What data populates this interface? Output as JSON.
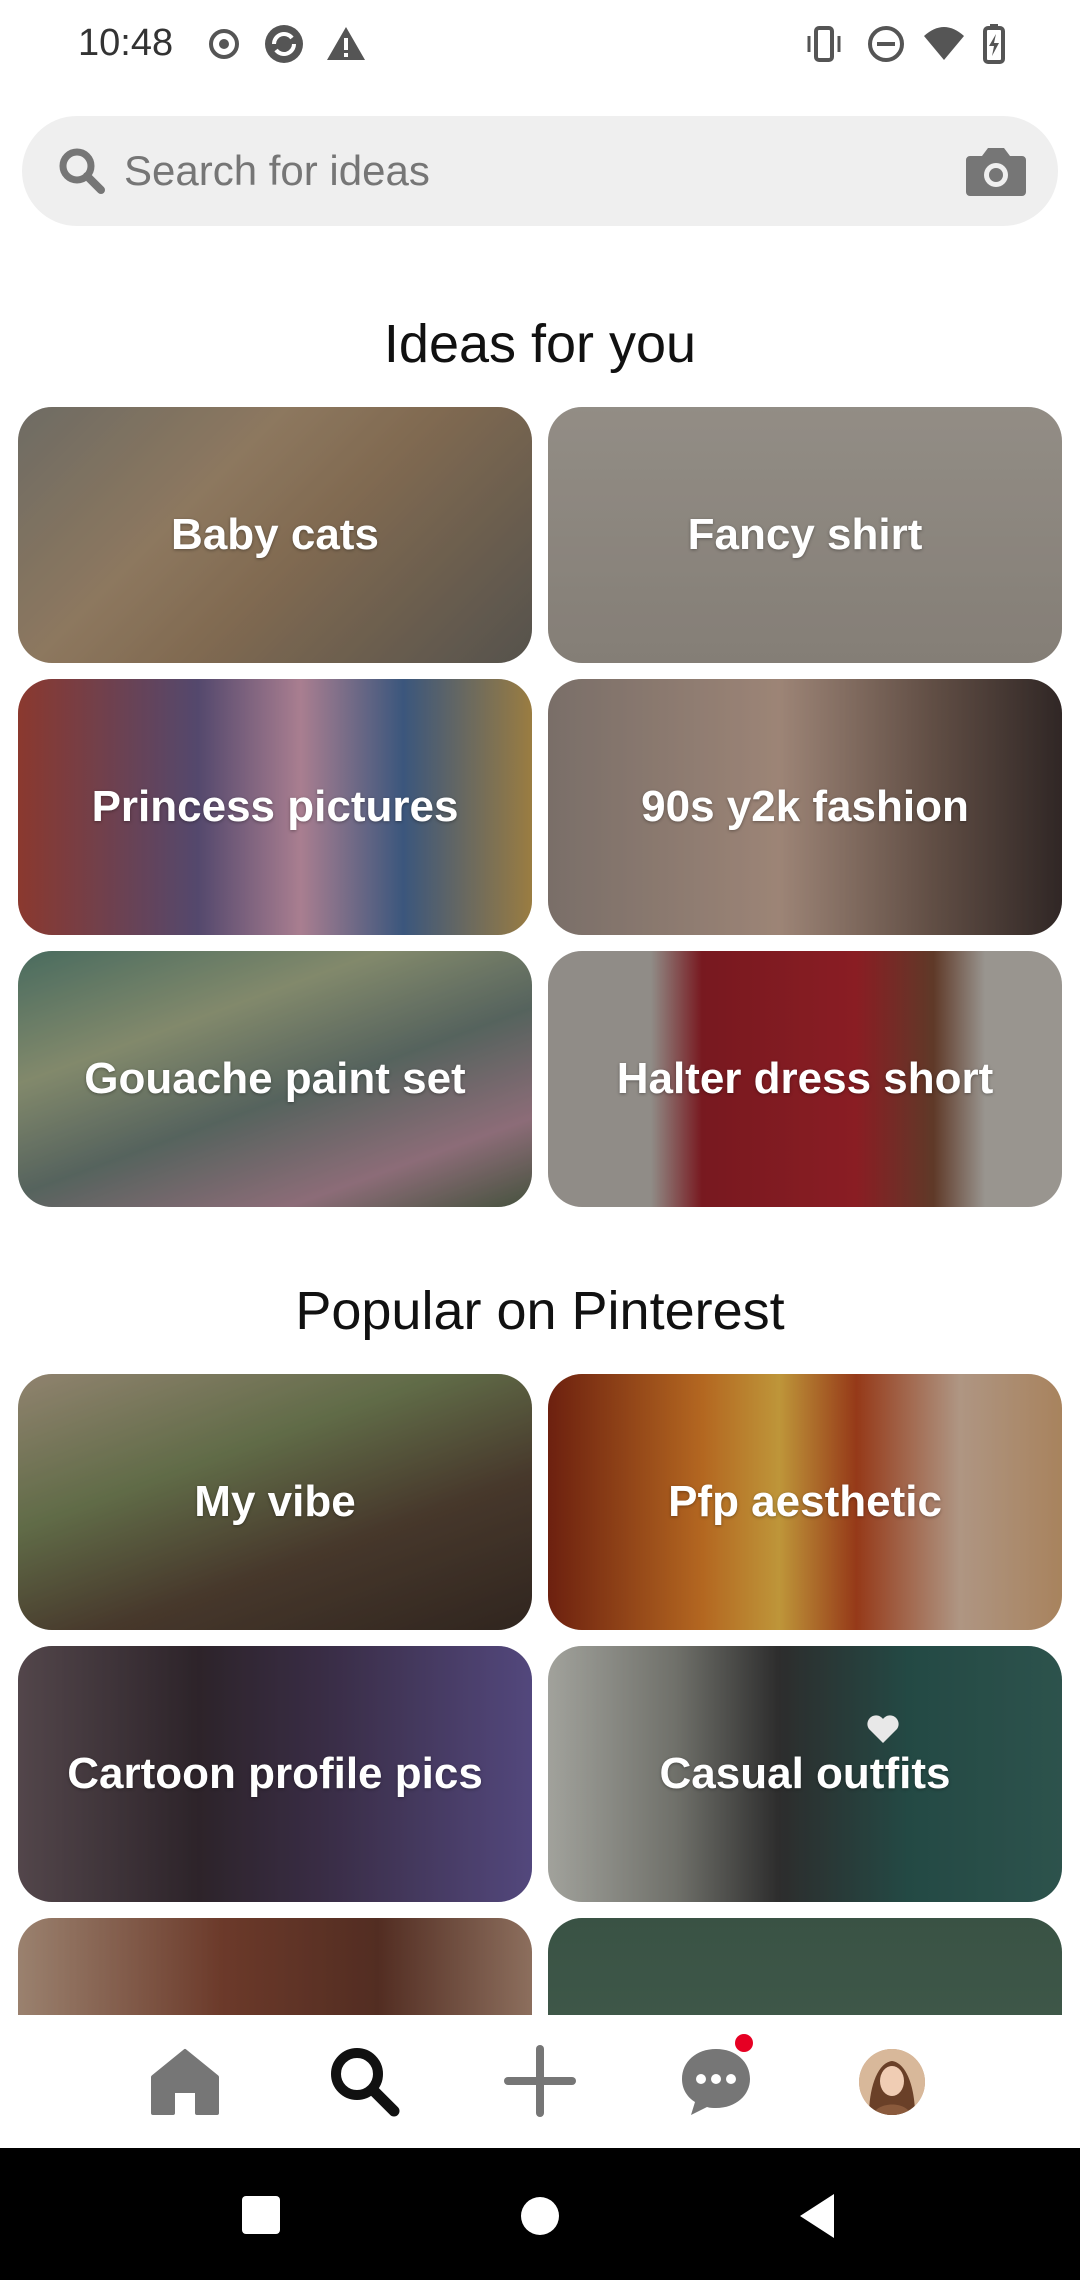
{
  "status_bar": {
    "time": "10:48"
  },
  "search": {
    "placeholder": "Search for ideas"
  },
  "sections": {
    "ideas_title": "Ideas for you",
    "popular_title": "Popular on Pinterest"
  },
  "ideas": [
    {
      "label": "Baby cats"
    },
    {
      "label": "Fancy shirt"
    },
    {
      "label": "Princess pictures"
    },
    {
      "label": "90s y2k fashion"
    },
    {
      "label": "Gouache paint set"
    },
    {
      "label": "Halter dress short"
    }
  ],
  "popular": [
    {
      "label": "My vibe"
    },
    {
      "label": "Pfp aesthetic"
    },
    {
      "label": "Cartoon profile pics"
    },
    {
      "label": "Casual outfits"
    },
    {
      "label": ""
    },
    {
      "label": ""
    }
  ],
  "bottom_nav": {
    "items": [
      "home-icon",
      "search-icon",
      "plus-icon",
      "messages-icon",
      "profile-avatar"
    ],
    "active": "search",
    "notification_color": "#e60023"
  }
}
